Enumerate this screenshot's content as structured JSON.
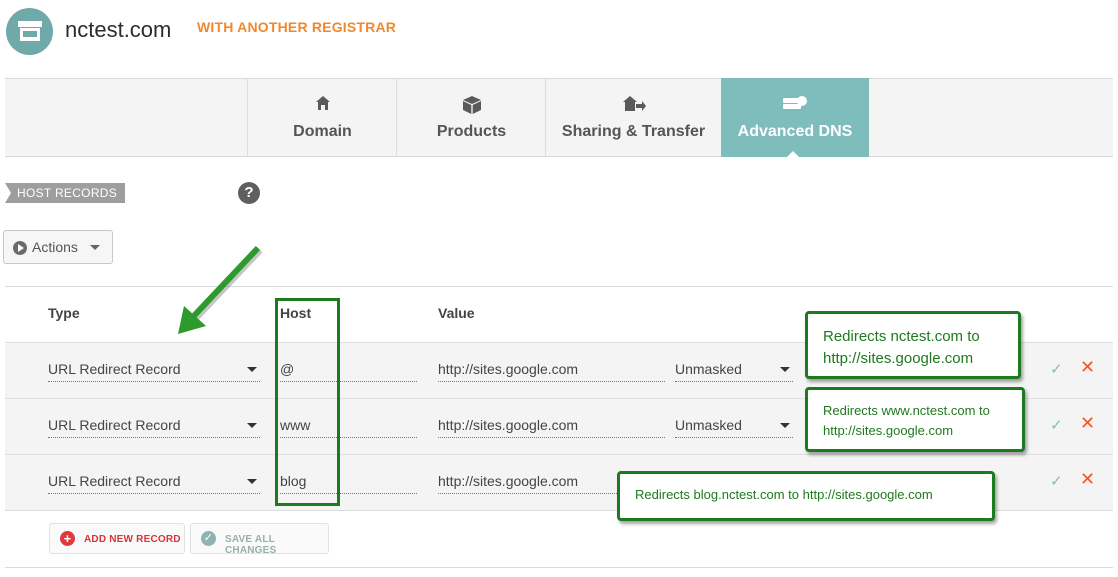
{
  "header": {
    "domain": "nctest.com",
    "registrar_status": "WITH ANOTHER REGISTRAR"
  },
  "tabs": [
    {
      "label": "Domain",
      "icon": "home-icon",
      "active": false
    },
    {
      "label": "Products",
      "icon": "box-icon",
      "active": false
    },
    {
      "label": "Sharing & Transfer",
      "icon": "share-transfer-icon",
      "active": false
    },
    {
      "label": "Advanced DNS",
      "icon": "dns-icon",
      "active": true
    }
  ],
  "host_records": {
    "label": "HOST RECORDS",
    "help": "?",
    "actions_label": "Actions"
  },
  "table": {
    "headers": {
      "type": "Type",
      "host": "Host",
      "value": "Value"
    },
    "rows": [
      {
        "type": "URL Redirect Record",
        "host": "@",
        "value": "http://sites.google.com",
        "mode": "Unmasked"
      },
      {
        "type": "URL Redirect Record",
        "host": "www",
        "value": "http://sites.google.com",
        "mode": "Unmasked"
      },
      {
        "type": "URL Redirect Record",
        "host": "blog",
        "value": "http://sites.google.com",
        "mode": ""
      }
    ]
  },
  "buttons": {
    "add": "ADD NEW RECORD",
    "save": "SAVE ALL CHANGES"
  },
  "annotations": {
    "callout1": {
      "line1": "Redirects nctest.com to",
      "line2": "http://sites.google.com"
    },
    "callout2": {
      "line1": "Redirects www.nctest.com to",
      "line2": "http://sites.google.com"
    },
    "callout3": {
      "line1": "Redirects blog.nctest.com to http://sites.google.com"
    }
  },
  "colors": {
    "accent_teal": "#7fbcbc",
    "registrar_orange": "#f0892e",
    "annotation_green": "#1e7a1e",
    "delete_red": "#f0582b"
  }
}
